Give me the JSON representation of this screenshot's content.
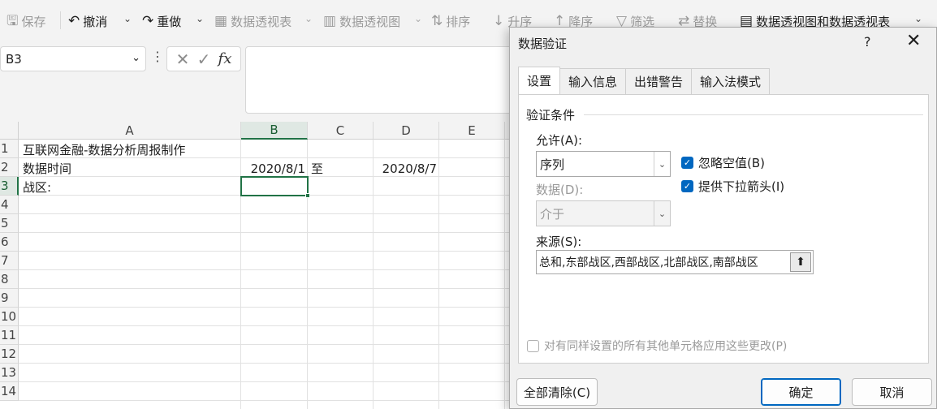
{
  "toolbar": {
    "save": "保存",
    "undo": "撤消",
    "redo": "重做",
    "pivot_table": "数据透视表",
    "pivot_chart": "数据透视图",
    "sort": "排序",
    "asc": "升序",
    "desc": "降序",
    "filter": "筛选",
    "replace": "替换",
    "pivot_combo": "数据透视图和数据透视表"
  },
  "formula_bar": {
    "name_box": "B3",
    "fx": "fx",
    "value": ""
  },
  "sheet": {
    "columns": [
      "A",
      "B",
      "C",
      "D",
      "E"
    ],
    "rows": [
      "1",
      "2",
      "3",
      "4",
      "5",
      "6",
      "7",
      "8",
      "9",
      "10",
      "11",
      "12",
      "13",
      "14"
    ],
    "selected_column": "B",
    "selected_row": "3",
    "cells": {
      "A1": "互联网金融-数据分析周报制作",
      "A2": "数据时间",
      "B2": "2020/8/1",
      "C2": "至",
      "D2": "2020/8/7",
      "A3": "战区:"
    }
  },
  "dialog": {
    "title": "数据验证",
    "help": "?",
    "tabs": [
      "设置",
      "输入信息",
      "出错警告",
      "输入法模式"
    ],
    "group_label": "验证条件",
    "allow_label": "允许(A):",
    "allow_value": "序列",
    "data_label": "数据(D):",
    "data_value": "介于",
    "ignore_blank": "忽略空值(B)",
    "in_cell_dropdown": "提供下拉箭头(I)",
    "source_label": "来源(S):",
    "source_value": "总和,东部战区,西部战区,北部战区,南部战区",
    "apply_all": "对有同样设置的所有其他单元格应用这些更改(P)",
    "clear_all": "全部清除(C)",
    "ok": "确定",
    "cancel": "取消"
  }
}
